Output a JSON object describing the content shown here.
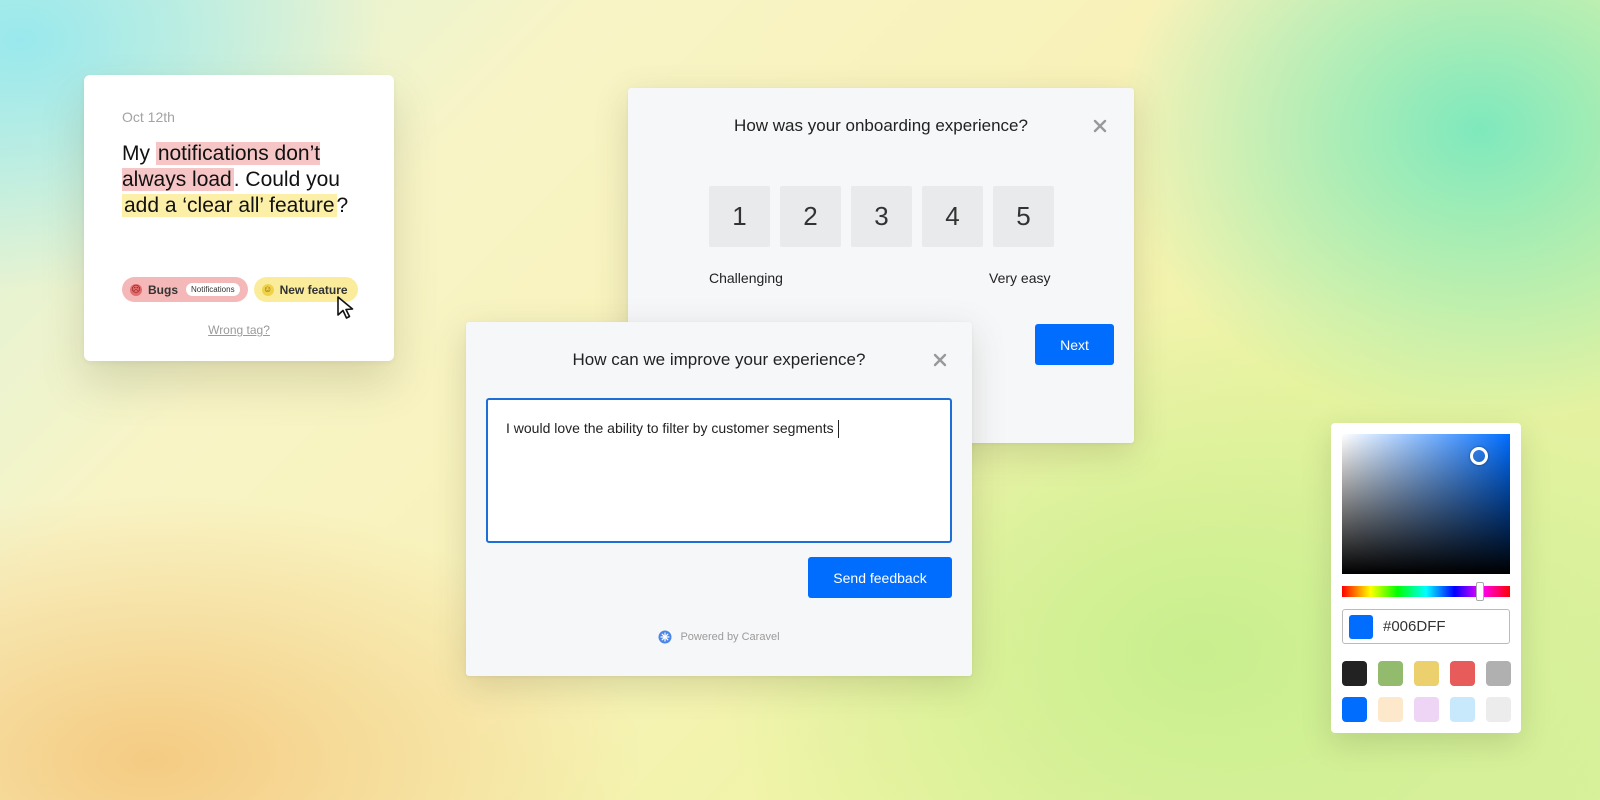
{
  "feedback_card": {
    "date": "Oct 12th",
    "text_part1": "My ",
    "text_highlight_red": "notifications don’t always load",
    "text_part2": ". Could you ",
    "text_highlight_yellow": "add a ‘clear all’ feature",
    "text_part3": "?",
    "tags": [
      {
        "label": "Bugs",
        "sublabel": "Notifications",
        "color": "#f4b8b8",
        "icon": "frown-face-icon"
      },
      {
        "label": "New feature",
        "color": "#fbec9c",
        "icon": "smile-face-icon"
      }
    ],
    "wrong_tag_link": "Wrong tag?"
  },
  "onboarding_survey": {
    "question": "How was your onboarding experience?",
    "scale": [
      "1",
      "2",
      "3",
      "4",
      "5"
    ],
    "label_low": "Challenging",
    "label_high": "Very easy",
    "next_button": "Next"
  },
  "improve_survey": {
    "question": "How can we improve your experience?",
    "input_value": "I would love the ability to filter by customer segments",
    "submit_button": "Send feedback",
    "powered_by": "Powered by Caravel"
  },
  "color_picker": {
    "hex_value": "#006DFF",
    "current_color": "#006dff",
    "swatches_row1": [
      "#222222",
      "#92bb6e",
      "#ecd06e",
      "#e85b5b",
      "#b0b0b0"
    ],
    "swatches_row2": [
      "#006dff",
      "#fde8cc",
      "#eed5f6",
      "#c8e8fb",
      "#ececec"
    ]
  },
  "colors": {
    "primary": "#006dff"
  }
}
